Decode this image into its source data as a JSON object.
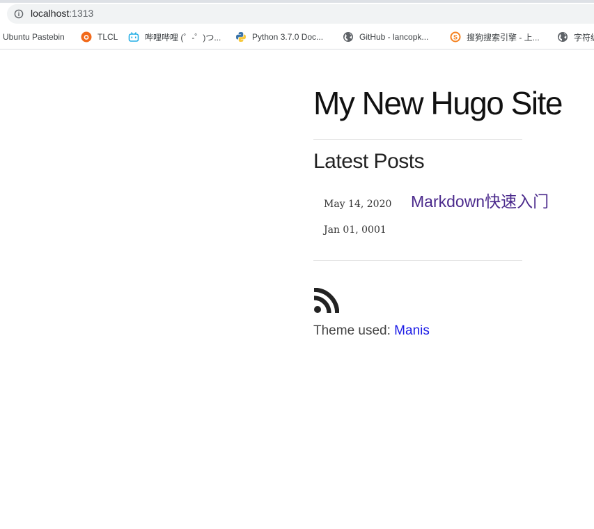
{
  "browser": {
    "url_host": "localhost",
    "url_port": ":1313",
    "bookmarks": [
      {
        "label": "Ubuntu Pastebin",
        "icon": "none"
      },
      {
        "label": "TLCL",
        "icon": "tlcl-icon"
      },
      {
        "label": "哔哩哔哩 (゜-゜)つ...",
        "icon": "bilibili-icon"
      },
      {
        "label": "Python 3.7.0 Doc...",
        "icon": "python-icon"
      },
      {
        "label": "GitHub - lancopk...",
        "icon": "globe-icon"
      },
      {
        "label": "搜狗搜索引擎 - 上...",
        "icon": "sogou-icon"
      },
      {
        "label": "字符编",
        "icon": "globe-icon"
      }
    ]
  },
  "site": {
    "title": "My New Hugo Site",
    "latest_heading": "Latest Posts",
    "posts": [
      {
        "date": "May 14, 2020",
        "title": "Markdown快速入门"
      },
      {
        "date": "Jan 01, 0001",
        "title": ""
      }
    ],
    "footer": {
      "theme_prefix": "Theme used: ",
      "theme_name": "Manis"
    }
  },
  "colors": {
    "visited_link": "#4b2a8c",
    "link": "#1a1ae6",
    "rss": "#222222"
  }
}
